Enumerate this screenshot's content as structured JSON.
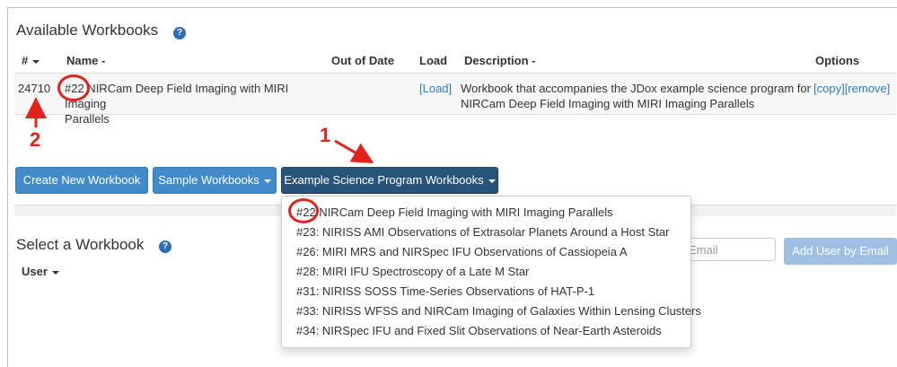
{
  "available": {
    "title": "Available Workbooks",
    "help_icon": "?",
    "columns": {
      "id": "#",
      "name": "Name",
      "out_of_date": "Out of Date",
      "load": "Load",
      "description": "Description",
      "options": "Options"
    },
    "row": {
      "id": "24710",
      "name_line1": "#22 NIRCam Deep Field Imaging with MIRI Imaging",
      "name_line2": "Parallels",
      "load": "[Load]",
      "desc_line1": "Workbook that accompanies the JDox example science program for",
      "desc_line2": "NIRCam Deep Field Imaging with MIRI Imaging Parallels",
      "copy": "[copy]",
      "remove": "[remove]"
    }
  },
  "toolbar": {
    "create": "Create New Workbook",
    "sample": "Sample Workbooks",
    "example": "Example Science Program Workbooks"
  },
  "dropdown": {
    "items": [
      "#22 NIRCam Deep Field Imaging with MIRI Imaging Parallels",
      "#23: NIRISS AMI Observations of Extrasolar Planets Around a Host Star",
      "#26: MIRI MRS and NIRSpec IFU Observations of Cassiopeia A",
      "#28: MIRI IFU Spectroscopy of a Late M Star",
      "#31: NIRISS SOSS Time-Series Observations of HAT-P-1",
      "#33: NIRISS WFSS and NIRCam Imaging of Galaxies Within Lensing Clusters",
      "#34: NIRSpec IFU and Fixed Slit Observations of Near-Earth Asteroids"
    ]
  },
  "select": {
    "title": "Select a Workbook",
    "user_col": "User",
    "email_placeholder": "Email",
    "add_user": "Add User by Email"
  },
  "annotations": {
    "one": "1",
    "two": "2"
  },
  "colors": {
    "accent": "#428bca",
    "dark_button": "#29547a",
    "annotation_red": "#e1231b"
  }
}
